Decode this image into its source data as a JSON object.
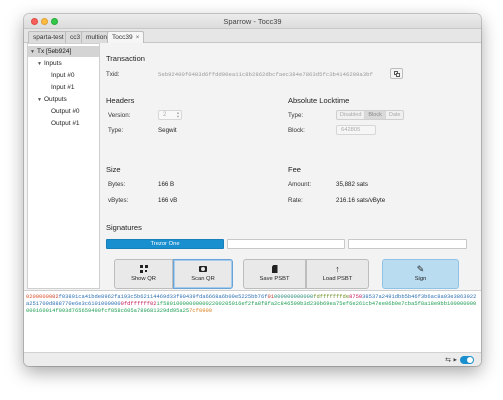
{
  "window": {
    "title": "Sparrow - Tocc39"
  },
  "tabs": [
    {
      "label": "sparta-test"
    },
    {
      "label": "cc3"
    },
    {
      "label": "multione"
    },
    {
      "label": "Tocc39",
      "close": "×"
    }
  ],
  "tree": {
    "root": "Tx [5eb924]",
    "inputs": "Inputs",
    "input0": "Input #0",
    "input1": "Input #1",
    "outputs": "Outputs",
    "output0": "Output #0",
    "output1": "Output #1"
  },
  "transaction": {
    "title": "Transaction",
    "txid_label": "Txid:",
    "txid": "5eb92400f0483d6ffdd00ea11c8b2862dbcfaec384e7863d5fc3b4146209a3bf"
  },
  "headers": {
    "title": "Headers",
    "version_label": "Version:",
    "version": "2",
    "type_label": "Type:",
    "type": "Segwit"
  },
  "locktime": {
    "title": "Absolute Locktime",
    "type_label": "Type:",
    "options": [
      "Disabled",
      "Block",
      "Date"
    ],
    "selected": "Block",
    "block_label": "Block:",
    "block": "642805"
  },
  "size": {
    "title": "Size",
    "bytes_label": "Bytes:",
    "bytes": "166 B",
    "vbytes_label": "vBytes:",
    "vbytes": "166 vB"
  },
  "fee": {
    "title": "Fee",
    "amount_label": "Amount:",
    "amount": "35,882 sats",
    "rate_label": "Rate:",
    "rate": "216.16 sats/vByte"
  },
  "signatures": {
    "title": "Signatures",
    "signers": [
      "Trezor One",
      "",
      ""
    ]
  },
  "actions": {
    "show_qr": "Show QR",
    "scan_qr": "Scan QR",
    "save_psbt": "Save PSBT",
    "load_psbt": "Load PSBT",
    "sign": "Sign"
  },
  "hex": {
    "version": "02000000",
    "flag": "02",
    "txid": "f03801ca41bde8962fa193c5b62114469d33f90439fda6668a6b09e5225bb76f",
    "vout": "01",
    "script": "000000000000",
    "seq": "fdffffff",
    "count": "fde",
    "val1": "8750",
    "out1": "38537a2491dbb5b46f3b6ac8a03e3863922a251709d888770e6e3c6101000000",
    "val2": "0fdffffff02",
    "out2": "1f580100000000002200205016ef2fa8f8fa2c846599b3d230b69ea75ef6e261cb47ee06b0e7cba5f8a18e9bb100000000000160014f093d765659490fcf858c605a789681329dd95a25",
    "lock": "7cf0900"
  },
  "status": {
    "usb_icon": "usb-icon",
    "toggle_on": true
  },
  "colors": {
    "accent": "#1a8fcf",
    "sign_bg": "#b9dcf1"
  }
}
